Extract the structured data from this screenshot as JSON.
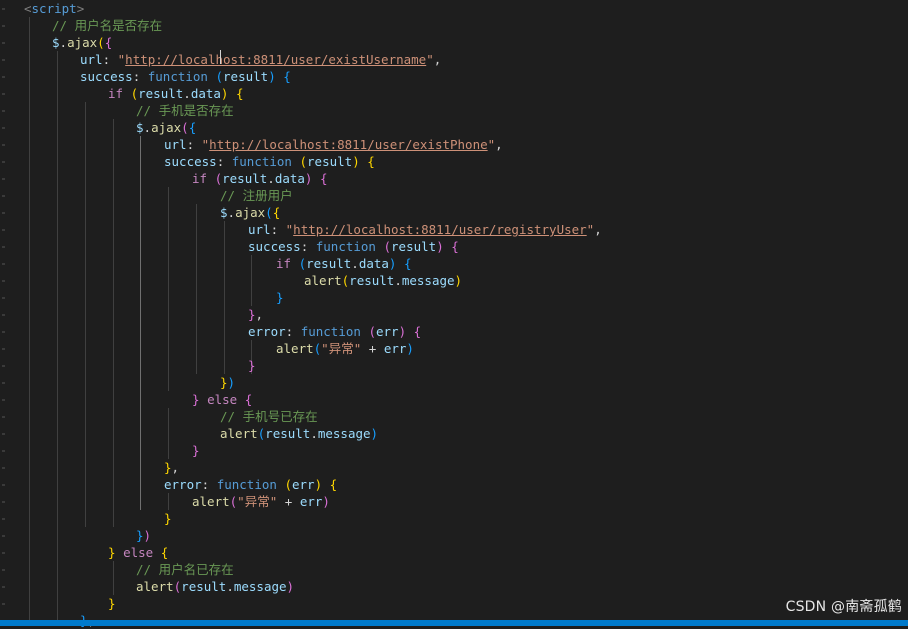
{
  "editor": {
    "lines": [
      "<script>",
      "// 用户名是否存在",
      "$.ajax({",
      "url: \"http://localhost:8811/user/existUsername\",",
      "success: function (result) {",
      "if (result.data) {",
      "// 手机是否存在",
      "$.ajax({",
      "url: \"http://localhost:8811/user/existPhone\",",
      "success: function (result) {",
      "if (result.data) {",
      "// 注册用户",
      "$.ajax({",
      "url: \"http://localhost:8811/user/registryUser\",",
      "success: function (result) {",
      "if (result.data) {",
      "alert(result.message)",
      "}",
      "},",
      "error: function (err) {",
      "alert(\"异常\" + err)",
      "}",
      "})",
      "} else {",
      "// 手机号已存在",
      "alert(result.message)",
      "}",
      "},",
      "error: function (err) {",
      "alert(\"异常\" + err)",
      "}",
      "})",
      "} else {",
      "// 用户名已存在",
      "alert(result.message)",
      "}",
      "},"
    ],
    "tokens": {
      "script_open_lt": "<",
      "script_name": "script",
      "script_open_gt": ">",
      "comment_username": "// 用户名是否存在",
      "comment_phone": "// 手机是否存在",
      "comment_register": "// 注册用户",
      "comment_phone_exists": "// 手机号已存在",
      "comment_username_exists": "// 用户名已存在",
      "dollar": "$",
      "dot": ".",
      "ajax": "ajax",
      "url_key": "url",
      "success_key": "success",
      "error_key": "error",
      "function_kw": "function",
      "if_kw": "if",
      "else_kw": "else",
      "result": "result",
      "data": "data",
      "message": "message",
      "err": "err",
      "alert": "alert",
      "url1": "http://localhost:8811/user/existUsername",
      "url2": "http://localhost:8811/user/existPhone",
      "url3": "http://localhost:8811/user/registryUser",
      "exception_str": "\"异常\"",
      "quote": "\""
    }
  },
  "watermark": "CSDN @南斋孤鹤",
  "colors": {
    "background": "#1e1e1e",
    "comment": "#6a9955",
    "keyword": "#569cd6",
    "control": "#c586c0",
    "string": "#ce9178",
    "variable": "#9cdcfe",
    "function": "#dcdcaa",
    "status_bar": "#007acc"
  }
}
